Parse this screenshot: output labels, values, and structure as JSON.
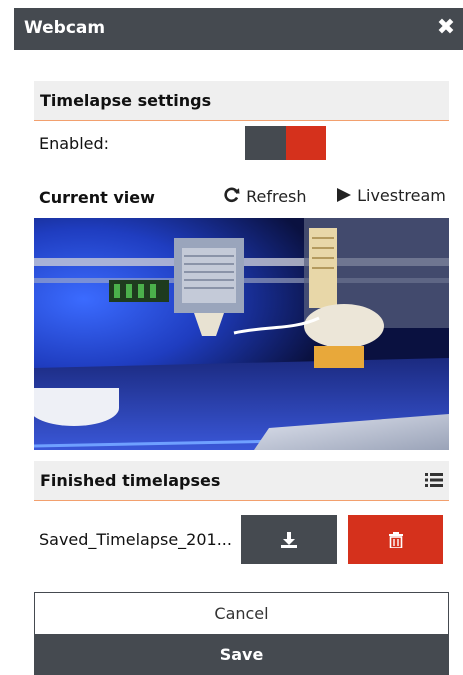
{
  "dialog": {
    "title": "Webcam",
    "close_label": "✖"
  },
  "timelapse_settings": {
    "heading": "Timelapse settings",
    "enabled_label": "Enabled:",
    "enabled_state": true
  },
  "current_view": {
    "heading": "Current view",
    "refresh_label": "Refresh",
    "livestream_label": "Livestream"
  },
  "finished_timelapses": {
    "heading": "Finished timelapses",
    "items": [
      {
        "name": "Saved_Timelapse_201..."
      }
    ]
  },
  "footer": {
    "cancel_label": "Cancel",
    "save_label": "Save"
  },
  "colors": {
    "titlebar": "#454a50",
    "accent_red": "#d5311c",
    "section_bg": "#efefef",
    "section_rule": "#f2a06e"
  },
  "icons": {
    "close": "close-icon",
    "refresh": "refresh-icon",
    "livestream": "play-icon",
    "list": "list-icon",
    "download": "download-icon",
    "delete": "trash-icon"
  }
}
